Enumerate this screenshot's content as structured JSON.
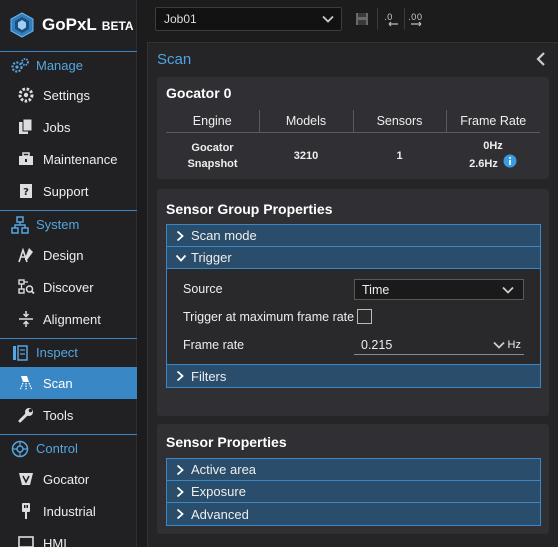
{
  "app": {
    "brand": "GoPxL",
    "beta": "BETA"
  },
  "sidebar": {
    "sections": [
      {
        "label": "Manage",
        "items": [
          {
            "label": "Settings"
          },
          {
            "label": "Jobs"
          },
          {
            "label": "Maintenance"
          },
          {
            "label": "Support"
          }
        ]
      },
      {
        "label": "System",
        "items": [
          {
            "label": "Design"
          },
          {
            "label": "Discover"
          },
          {
            "label": "Alignment"
          }
        ]
      },
      {
        "label": "Inspect",
        "items": [
          {
            "label": "Scan",
            "active": true
          },
          {
            "label": "Tools"
          }
        ]
      },
      {
        "label": "Control",
        "items": [
          {
            "label": "Gocator"
          },
          {
            "label": "Industrial"
          },
          {
            "label": "HMI"
          }
        ]
      }
    ]
  },
  "toolbar": {
    "job": "Job01"
  },
  "panel": {
    "title": "Scan",
    "status_card": {
      "title": "Gocator 0",
      "headers": [
        "Engine",
        "Models",
        "Sensors",
        "Frame Rate"
      ],
      "row": {
        "engine_line1": "Gocator",
        "engine_line2": "Snapshot",
        "models": "3210",
        "sensors": "1",
        "rate_line1": "0Hz",
        "rate_line2": "2.6Hz"
      }
    },
    "group_card": {
      "title": "Sensor Group Properties",
      "sections": [
        "Scan mode",
        "Trigger",
        "Filters"
      ],
      "trigger": {
        "source_label": "Source",
        "source_value": "Time",
        "max_rate_label": "Trigger at maximum frame rate",
        "max_rate_checked": false,
        "frame_rate_label": "Frame rate",
        "frame_rate_value": "0.215",
        "frame_rate_unit": "Hz"
      }
    },
    "sensor_card": {
      "title": "Sensor Properties",
      "sections": [
        "Active area",
        "Exposure",
        "Advanced"
      ]
    }
  },
  "colors": {
    "accent": "#3a87c6",
    "title_blue": "#4ea3e3",
    "section_header": "#2a4d6b"
  }
}
